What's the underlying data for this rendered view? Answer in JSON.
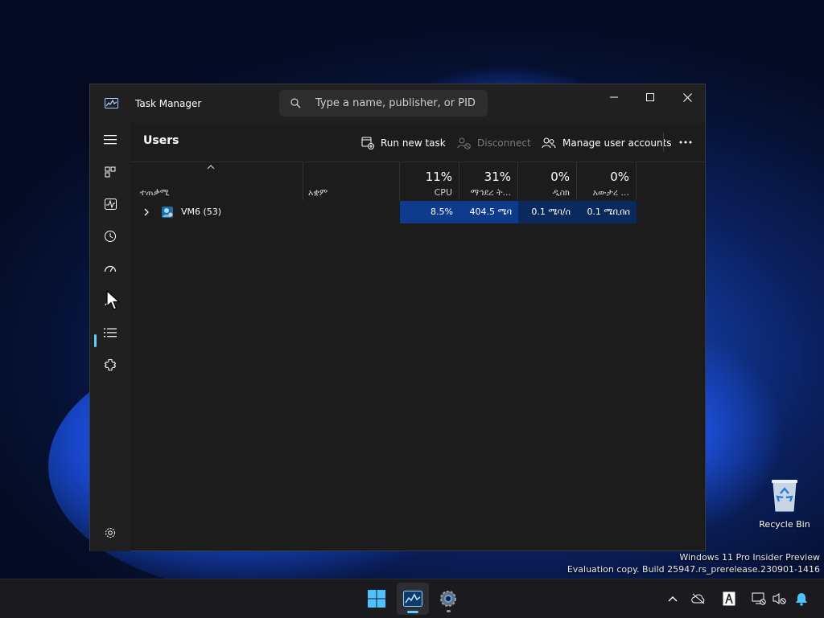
{
  "window": {
    "title": "Task Manager",
    "search_placeholder": "Type a name, publisher, or PID t...",
    "minimize": "minimize",
    "maximize": "maximize",
    "close": "close"
  },
  "sidebar": {
    "items": [
      {
        "icon": "hamburger-menu-icon"
      },
      {
        "icon": "processes-icon"
      },
      {
        "icon": "performance-icon"
      },
      {
        "icon": "app-history-icon"
      },
      {
        "icon": "startup-apps-icon"
      },
      {
        "icon": "users-icon",
        "active": true
      },
      {
        "icon": "details-icon"
      },
      {
        "icon": "services-icon"
      },
      {
        "icon": "settings-icon"
      }
    ]
  },
  "toolbar": {
    "page_title": "Users",
    "run_new_task": "Run new task",
    "disconnect": "Disconnect",
    "manage_accounts": "Manage user accounts"
  },
  "table": {
    "columns": [
      {
        "key": "user",
        "label": "ተጠቃሚ",
        "pct": ""
      },
      {
        "key": "status",
        "label": "አቋም",
        "pct": ""
      },
      {
        "key": "cpu",
        "label": "CPU",
        "pct": "11%"
      },
      {
        "key": "memory",
        "label": "ማኅደረ ት...",
        "pct": "31%"
      },
      {
        "key": "disk",
        "label": "ዲስክ",
        "pct": "0%"
      },
      {
        "key": "network",
        "label": "አውታረ ...",
        "pct": "0%"
      }
    ],
    "rows": [
      {
        "user": "VM6 (53)",
        "status": "",
        "cpu": "8.5%",
        "memory": "404.5 ሜባ",
        "disk": "0.1 ሜባ/ሰ",
        "network": "0.1 ሜቢበሰ"
      }
    ]
  },
  "desktop": {
    "recycle_bin": "Recycle Bin",
    "watermark_line1": "Windows 11 Pro Insider Preview",
    "watermark_line2": "Evaluation copy. Build 25947.rs_prerelease.230901-1416"
  },
  "colors": {
    "accent": "#60cdff",
    "heat": "#0e3b8c"
  }
}
